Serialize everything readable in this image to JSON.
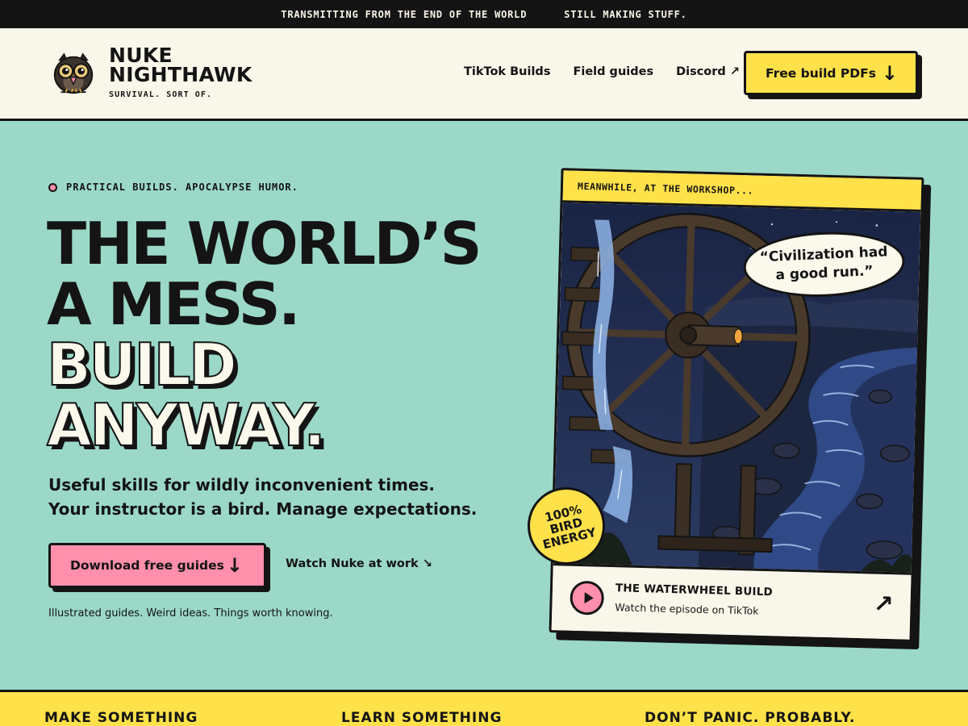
{
  "ticker": {
    "left": "TRANSMITTING FROM THE END OF THE WORLD",
    "right": "STILL MAKING STUFF."
  },
  "header": {
    "brand_line1": "NUKE",
    "brand_line2": "NIGHTHAWK",
    "tagline": "SURVIVAL. SORT OF.",
    "nav": [
      {
        "label": "TikTok Builds"
      },
      {
        "label": "Field guides"
      },
      {
        "label": "Discord ↗"
      }
    ],
    "cta_label": "Free build PDFs",
    "cta_icon": "↓"
  },
  "hero": {
    "eyebrow": "PRACTICAL BUILDS. APOCALYPSE HUMOR.",
    "headline": [
      "THE WORLD’S",
      "A MESS.",
      "BUILD",
      "ANYWAY."
    ],
    "subtitle": [
      "Useful skills for wildly inconvenient times.",
      "Your instructor is a bird. Manage expectations."
    ],
    "primary_button": "Download free guides",
    "primary_icon": "↓",
    "secondary_link": "Watch Nuke at work ↘",
    "fineprint": "Illustrated guides. Weird ideas. Things worth knowing."
  },
  "card": {
    "header": "MEANWHILE, AT THE WORKSHOP...",
    "quote_line1": "“Civilization had",
    "quote_line2": "a good run.”",
    "episode_title": "THE WATERWHEEL BUILD",
    "episode_sub": "Watch the episode on TikTok",
    "episode_arrow": "↗",
    "badge": [
      "100%",
      "BIRD",
      "ENERGY"
    ]
  },
  "strip": [
    "MAKE SOMETHING",
    "LEARN SOMETHING",
    "DON’T PANIC. PROBABLY."
  ],
  "colors": {
    "ink": "#141414",
    "cream": "#f9f6ea",
    "mint": "#9bd8c8",
    "yellow": "#ffe14a",
    "pink": "#ff8fab",
    "night": "#1f2b4a"
  }
}
